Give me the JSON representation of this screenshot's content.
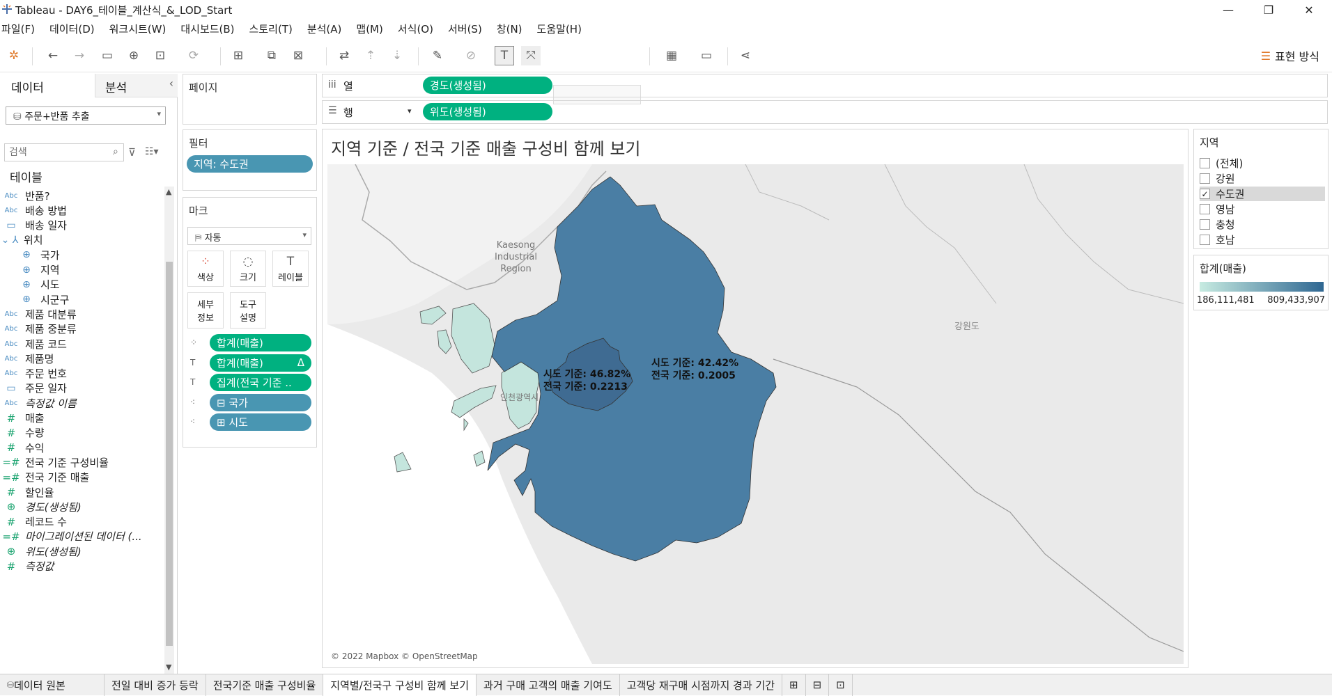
{
  "window": {
    "title": "Tableau - DAY6_테이블_계산식_&_LOD_Start",
    "minimize": "—",
    "restore": "❐",
    "close": "✕"
  },
  "menu": [
    "파일(F)",
    "데이터(D)",
    "워크시트(W)",
    "대시보드(B)",
    "스토리(T)",
    "분석(A)",
    "맵(M)",
    "서식(O)",
    "서버(S)",
    "창(N)",
    "도움말(H)"
  ],
  "toolbar": {
    "show_me": "표현 방식"
  },
  "left_pane": {
    "tab_data": "데이터",
    "tab_analysis": "분석",
    "datasource": "주문+반품 추출",
    "search_placeholder": "검색",
    "tables_header": "테이블",
    "fields": [
      {
        "type": "Abc",
        "name": "반품?",
        "indent": 0,
        "italic": false
      },
      {
        "type": "Abc",
        "name": "배송 방법",
        "indent": 0,
        "italic": false
      },
      {
        "type": "date",
        "name": "배송 일자",
        "indent": 0,
        "italic": false
      },
      {
        "type": "hier",
        "name": "위치",
        "indent": 0,
        "italic": false
      },
      {
        "type": "geo",
        "name": "국가",
        "indent": 1,
        "italic": false
      },
      {
        "type": "geo",
        "name": "지역",
        "indent": 1,
        "italic": false
      },
      {
        "type": "geo",
        "name": "시도",
        "indent": 1,
        "italic": false
      },
      {
        "type": "geo",
        "name": "시군구",
        "indent": 1,
        "italic": false
      },
      {
        "type": "Abc",
        "name": "제품 대분류",
        "indent": 0,
        "italic": false
      },
      {
        "type": "Abc",
        "name": "제품 중분류",
        "indent": 0,
        "italic": false
      },
      {
        "type": "Abc",
        "name": "제품 코드",
        "indent": 0,
        "italic": false
      },
      {
        "type": "Abc",
        "name": "제품명",
        "indent": 0,
        "italic": false
      },
      {
        "type": "Abc",
        "name": "주문 번호",
        "indent": 0,
        "italic": false
      },
      {
        "type": "date",
        "name": "주문 일자",
        "indent": 0,
        "italic": false
      },
      {
        "type": "Abc",
        "name": "측정값 이름",
        "indent": 0,
        "italic": true
      },
      {
        "type": "num",
        "name": "매출",
        "indent": 0,
        "italic": false
      },
      {
        "type": "num",
        "name": "수량",
        "indent": 0,
        "italic": false
      },
      {
        "type": "num",
        "name": "수익",
        "indent": 0,
        "italic": false
      },
      {
        "type": "calc",
        "name": "전국 기준 구성비율",
        "indent": 0,
        "italic": false
      },
      {
        "type": "calc",
        "name": "전국 기준 매출",
        "indent": 0,
        "italic": false
      },
      {
        "type": "num",
        "name": "할인율",
        "indent": 0,
        "italic": false
      },
      {
        "type": "globe",
        "name": "경도(생성됨)",
        "indent": 0,
        "italic": true
      },
      {
        "type": "num",
        "name": "레코드 수",
        "indent": 0,
        "italic": false
      },
      {
        "type": "calc",
        "name": "마이그레이션된 데이터 (...",
        "indent": 0,
        "italic": true
      },
      {
        "type": "globe",
        "name": "위도(생성됨)",
        "indent": 0,
        "italic": true
      },
      {
        "type": "num",
        "name": "측정값",
        "indent": 0,
        "italic": true
      }
    ]
  },
  "shelves": {
    "pages_title": "페이지",
    "filters_title": "필터",
    "filter_pill": "지역: 수도권",
    "marks_title": "마크",
    "mark_type": "자동",
    "mark_buttons": [
      "색상",
      "크기",
      "레이블",
      "세부\n정보",
      "도구\n설명"
    ],
    "mark_pills": [
      {
        "icon": "color-icon",
        "label": "합계(매출)",
        "color": "green"
      },
      {
        "icon": "label-icon",
        "label": "합계(매출)",
        "suffix": "Δ",
        "color": "green"
      },
      {
        "icon": "label-icon",
        "label": "집계(전국 기준 ..",
        "color": "green"
      },
      {
        "icon": "detail-icon",
        "label": "⊟ 국가",
        "color": "blue"
      },
      {
        "icon": "detail-icon",
        "label": "⊞ 시도",
        "color": "blue"
      }
    ],
    "columns_label": "열",
    "columns_pill": "경도(생성됨)",
    "rows_label": "행",
    "rows_pill": "위도(생성됨)"
  },
  "viz": {
    "title": "지역 기준 / 전국 기준 매출 구성비 함께 보기",
    "labels": [
      {
        "line1": "시도 기준: 46.82%",
        "line2": "전국 기준: 0.2213"
      },
      {
        "line1": "시도 기준: 42.42%",
        "line2": "전국 기준: 0.2005"
      }
    ],
    "map_labels": {
      "kaesong": "Kaesong\nIndustrial\nRegion",
      "gangwon": "강원도",
      "incheon": "인천광역시"
    },
    "attribution": "© 2022 Mapbox © OpenStreetMap",
    "colors": {
      "gyeonggi": "#4a7ea4",
      "seoul": "#3f6b92",
      "incheon": "#c4e5dd"
    }
  },
  "region_legend": {
    "title": "지역",
    "items": [
      {
        "label": "(전체)",
        "checked": false
      },
      {
        "label": "강원",
        "checked": false
      },
      {
        "label": "수도권",
        "checked": true
      },
      {
        "label": "영남",
        "checked": false
      },
      {
        "label": "충청",
        "checked": false
      },
      {
        "label": "호남",
        "checked": false
      }
    ]
  },
  "sales_legend": {
    "title": "합계(매출)",
    "min": "186,111,481",
    "max": "809,433,907",
    "color_low": "#c7ebe1",
    "color_high": "#2f6792"
  },
  "bottom_tabs": {
    "datasource": "데이터 원본",
    "sheets": [
      "전일 대비 증가 등락",
      "전국기준 매출 구성비율",
      "지역별/전국구 구성비 함께 보기",
      "과거 구매 고객의 매출 기여도",
      "고객당 재구매 시점까지 경과 기간"
    ],
    "active": 2
  }
}
